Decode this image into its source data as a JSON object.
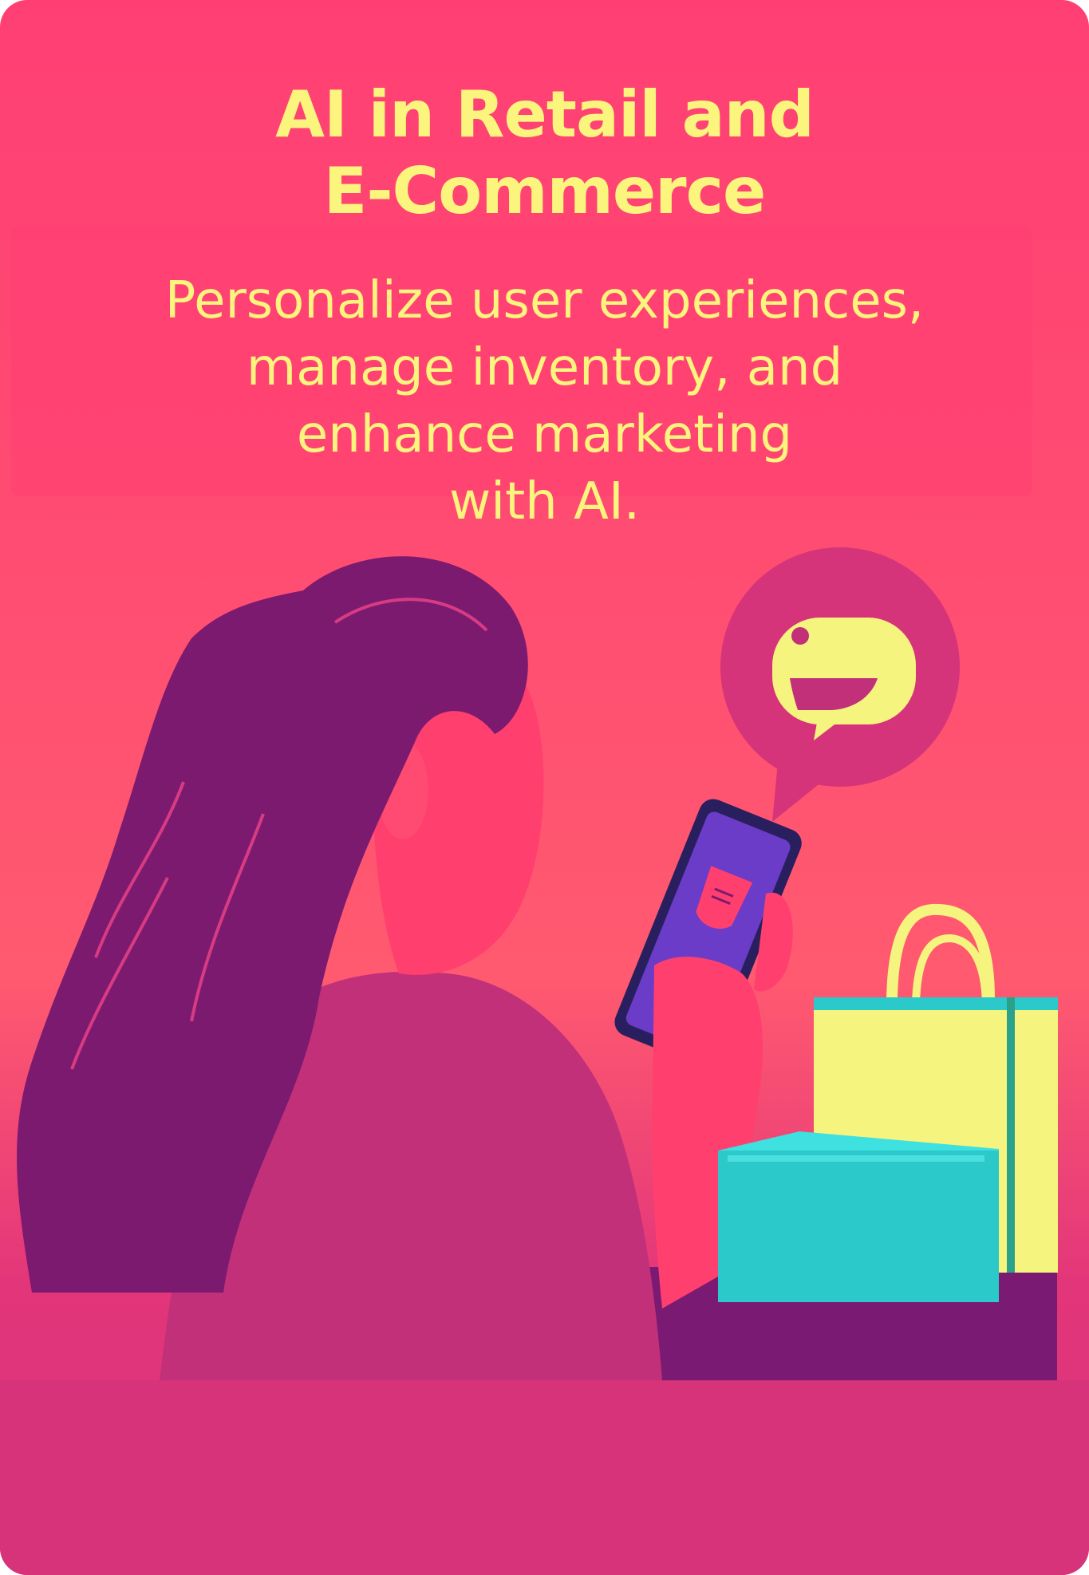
{
  "card": {
    "title_line1": "AI in Retail and",
    "title_line2": "E-Commerce",
    "description_lines": [
      "Personalize user experiences,",
      "manage inventory, and",
      "enhance marketing",
      "with AI."
    ]
  },
  "illustration": {
    "subject": "woman-using-phone",
    "icons": [
      "chat-bubble-icon",
      "smartphone-icon",
      "shopping-bag-icon",
      "gift-box-icon"
    ]
  },
  "colors": {
    "background": "#ff4a72",
    "text": "#fbf57e",
    "hair": "#7c1a70",
    "phone_screen": "#6a3cc8",
    "box": "#2bc9c9",
    "bag": "#f4f47e"
  }
}
